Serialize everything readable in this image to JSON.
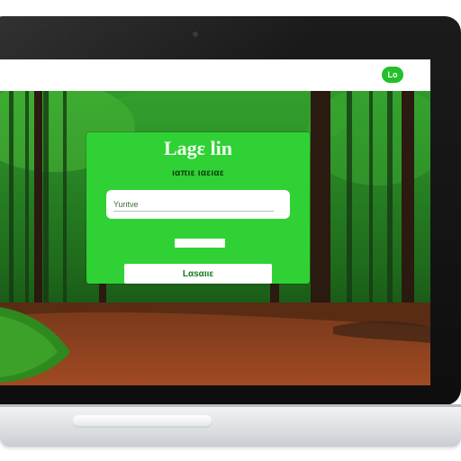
{
  "topbar": {
    "badge_label": "Lo"
  },
  "login": {
    "title": "Lagε lin",
    "subtitle": "ιαπιε ιαειαε",
    "username_placeholder": "Yurιtνe",
    "button_label": "Lαsαιιε"
  },
  "colors": {
    "accent_green": "#2fd135",
    "badge_green": "#22c02a",
    "bezel": "#111111",
    "base_silver": "#dcdfe2"
  },
  "icons": {
    "camera": "camera-icon"
  }
}
